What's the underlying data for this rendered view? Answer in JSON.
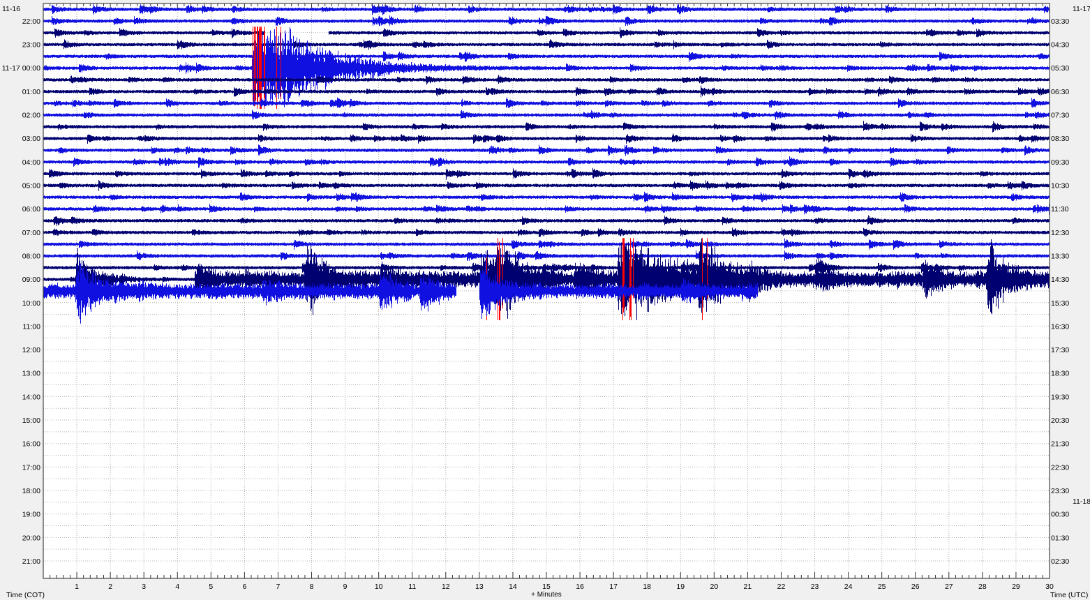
{
  "chart_data": {
    "type": "helicorder",
    "title": "",
    "xlabel": "+ Minutes",
    "xlim": [
      0,
      30
    ],
    "x_ticks": [
      "1",
      "2",
      "3",
      "4",
      "5",
      "6",
      "7",
      "8",
      "9",
      "10",
      "11",
      "12",
      "13",
      "14",
      "15",
      "16",
      "17",
      "18",
      "19",
      "20",
      "21",
      "22",
      "23",
      "24",
      "25",
      "26",
      "27",
      "28",
      "29",
      "30"
    ],
    "left_axis_label": "Time (COT)",
    "right_axis_label": "Time (UTC)",
    "minutes_per_row": 30,
    "total_rows": 48,
    "rows_recorded": 25,
    "last_row_end_minute": 21.3,
    "grid": true,
    "date_labels": [
      {
        "side": "left",
        "row": 0,
        "text": "11-16"
      },
      {
        "side": "right",
        "row": 0,
        "text": "11-17"
      },
      {
        "side": "right",
        "row": 41.95,
        "text": "11-18"
      }
    ],
    "left_labels": [
      {
        "row": 1,
        "text": "22:00"
      },
      {
        "row": 3,
        "text": "23:00"
      },
      {
        "row": 5,
        "text": "11-17 00:00"
      },
      {
        "row": 7,
        "text": "01:00"
      },
      {
        "row": 9,
        "text": "02:00"
      },
      {
        "row": 11,
        "text": "03:00"
      },
      {
        "row": 13,
        "text": "04:00"
      },
      {
        "row": 15,
        "text": "05:00"
      },
      {
        "row": 17,
        "text": "06:00"
      },
      {
        "row": 19,
        "text": "07:00"
      },
      {
        "row": 21,
        "text": "08:00"
      },
      {
        "row": 23,
        "text": "09:00"
      },
      {
        "row": 25,
        "text": "10:00"
      },
      {
        "row": 27,
        "text": "11:00"
      },
      {
        "row": 29,
        "text": "12:00"
      },
      {
        "row": 31,
        "text": "13:00"
      },
      {
        "row": 33,
        "text": "14:00"
      },
      {
        "row": 35,
        "text": "15:00"
      },
      {
        "row": 37,
        "text": "16:00"
      },
      {
        "row": 39,
        "text": "17:00"
      },
      {
        "row": 41,
        "text": "18:00"
      },
      {
        "row": 43,
        "text": "19:00"
      },
      {
        "row": 45,
        "text": "20:00"
      },
      {
        "row": 47,
        "text": "21:00"
      }
    ],
    "right_labels": [
      {
        "row": 1,
        "text": "03:30"
      },
      {
        "row": 3,
        "text": "04:30"
      },
      {
        "row": 5,
        "text": "05:30"
      },
      {
        "row": 7,
        "text": "06:30"
      },
      {
        "row": 9,
        "text": "07:30"
      },
      {
        "row": 11,
        "text": "08:30"
      },
      {
        "row": 13,
        "text": "09:30"
      },
      {
        "row": 15,
        "text": "10:30"
      },
      {
        "row": 17,
        "text": "11:30"
      },
      {
        "row": 19,
        "text": "12:30"
      },
      {
        "row": 21,
        "text": "13:30"
      },
      {
        "row": 23,
        "text": "14:30"
      },
      {
        "row": 25,
        "text": "15:30"
      },
      {
        "row": 27,
        "text": "16:30"
      },
      {
        "row": 29,
        "text": "17:30"
      },
      {
        "row": 31,
        "text": "18:30"
      },
      {
        "row": 33,
        "text": "19:30"
      },
      {
        "row": 35,
        "text": "20:30"
      },
      {
        "row": 37,
        "text": "21:30"
      },
      {
        "row": 39,
        "text": "22:30"
      },
      {
        "row": 41,
        "text": "23:30"
      },
      {
        "row": 43,
        "text": "00:30"
      },
      {
        "row": 45,
        "text": "01:30"
      },
      {
        "row": 47,
        "text": "02:30"
      }
    ],
    "colors": {
      "trace_cycle": [
        "#1010e0",
        "#1010e0",
        "#000070",
        "#000070"
      ],
      "clipped": "#ff0000",
      "plot_bg": "#ffffff",
      "grid": "#b0b0b0"
    },
    "clip_level_rows": 3.5,
    "background_noise_rows": 0.12,
    "events": [
      {
        "row": 5,
        "start_min": 6.2,
        "peak_rows": 7.5,
        "decay_min": 1.6,
        "end_min": 15.5
      },
      {
        "row": 23,
        "start_min": 0.95,
        "peak_rows": 4.0,
        "decay_min": 0.5,
        "end_min": 3.5
      },
      {
        "row": 23,
        "start_min": 4.5,
        "peak_rows": 1.3,
        "decay_min": 0.5,
        "end_min": 6.5
      },
      {
        "row": 23,
        "start_min": 7.8,
        "peak_rows": 3.6,
        "decay_min": 0.6,
        "end_min": 10.5
      },
      {
        "row": 23,
        "start_min": 10.0,
        "peak_rows": 1.0,
        "decay_min": 0.6,
        "end_min": 12
      },
      {
        "row": 23,
        "start_min": 13.0,
        "peak_rows": 4.5,
        "decay_min": 0.5,
        "end_min": 15
      },
      {
        "row": 23,
        "start_min": 13.5,
        "peak_rows": 4.2,
        "decay_min": 0.6,
        "end_min": 15.5
      },
      {
        "row": 23,
        "start_min": 15.8,
        "peak_rows": 1.5,
        "decay_min": 0.6,
        "end_min": 17
      },
      {
        "row": 23,
        "start_min": 17.1,
        "peak_rows": 5.0,
        "decay_min": 1.4,
        "end_min": 19.5
      },
      {
        "row": 23,
        "start_min": 19.5,
        "peak_rows": 4.8,
        "decay_min": 0.7,
        "end_min": 21
      },
      {
        "row": 23,
        "start_min": 21.0,
        "peak_rows": 1.9,
        "decay_min": 0.4,
        "end_min": 22
      },
      {
        "row": 23,
        "start_min": 23.0,
        "peak_rows": 0.8,
        "decay_min": 0.4,
        "end_min": 24
      },
      {
        "row": 23,
        "start_min": 26.2,
        "peak_rows": 2.2,
        "decay_min": 0.4,
        "end_min": 27.2
      },
      {
        "row": 23,
        "start_min": 28.1,
        "peak_rows": 4.5,
        "decay_min": 0.5,
        "end_min": 29.6
      },
      {
        "row": 22,
        "start_min": 23.0,
        "peak_rows": 0.9,
        "decay_min": 0.3,
        "end_min": 23.8
      },
      {
        "row": 24,
        "start_min": 0.95,
        "peak_rows": 2.8,
        "decay_min": 0.6,
        "end_min": 3
      },
      {
        "row": 24,
        "start_min": 6.5,
        "peak_rows": 0.9,
        "decay_min": 0.4,
        "end_min": 8
      },
      {
        "row": 24,
        "start_min": 10.0,
        "peak_rows": 2.3,
        "decay_min": 0.4,
        "end_min": 11
      },
      {
        "row": 24,
        "start_min": 11.2,
        "peak_rows": 2.0,
        "decay_min": 0.4,
        "end_min": 12.3
      },
      {
        "row": 24,
        "start_min": 13.0,
        "peak_rows": 3.8,
        "decay_min": 0.4,
        "end_min": 14.5
      },
      {
        "row": 24,
        "start_min": 19.0,
        "peak_rows": 1.0,
        "decay_min": 0.4,
        "end_min": 20
      }
    ],
    "elevated_noise": [
      {
        "row": 23,
        "start_min": 4.5,
        "end_min": 30,
        "level_rows": 0.55
      },
      {
        "row": 24,
        "start_min": 0,
        "end_min": 12.3,
        "level_rows": 0.55
      },
      {
        "row": 24,
        "start_min": 13,
        "end_min": 21.3,
        "level_rows": 0.5
      }
    ],
    "gaps": [
      {
        "row": 24,
        "start_min": 12.3,
        "end_min": 13.0
      },
      {
        "row": 2,
        "start_min": 6.6,
        "end_min": 8.5
      }
    ]
  }
}
